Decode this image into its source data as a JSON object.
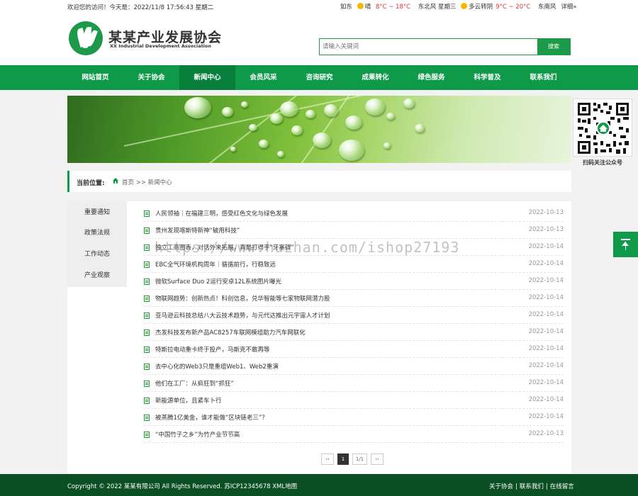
{
  "topbar": {
    "welcome": "欢迎您的访问！今天是：2022/11/8 17:56:43 星期二",
    "weather_city": "如东",
    "weather_today_text": "晴",
    "weather_today_temp": "8°C ~ 18°C",
    "weather_today_wind": "东北风 星期三",
    "weather_tomorrow_text": "多云转阴",
    "weather_tomorrow_temp": "9°C ~ 20°C",
    "weather_tomorrow_wind": "东南风",
    "weather_more": "详细»"
  },
  "header": {
    "logo_cn": "某某产业发展协会",
    "logo_en": "XX Industrial Development Association",
    "search_placeholder": "请输入关键词",
    "search_button": "搜索"
  },
  "nav": {
    "items": [
      "网站首页",
      "关于协会",
      "新闻中心",
      "会员风采",
      "咨询研究",
      "成果转化",
      "绿色服务",
      "科学普及",
      "联系我们"
    ],
    "active_index": 2
  },
  "qr": {
    "caption": "扫码关注公众号"
  },
  "breadcrumb": {
    "label": "当前位置:",
    "path": "首页 >> 新闻中心"
  },
  "sidebar": {
    "items": [
      "重要通知",
      "政策法规",
      "工作动态",
      "产业观察"
    ]
  },
  "news": [
    {
      "title": "人民领袖｜在福建三明，感受红色文化与绿色发展",
      "date": "2022-10-13"
    },
    {
      "title": "贵州发现喀斯特新神“破用科技”",
      "date": "2022-10-13"
    },
    {
      "title": "独立工商图表，对话外来拓展，真是打得手“牙塞碍”",
      "date": "2022-10-14"
    },
    {
      "title": "EBC全气环境机构周年｜循循前行，行稳致远",
      "date": "2022-10-14"
    },
    {
      "title": "微软Surface Duo 2运行安卓12L系统图片曝光",
      "date": "2022-10-14"
    },
    {
      "title": "物联网趋势：创新热点！科创信息，兑华智能等七家物联网潜力股",
      "date": "2022-10-14"
    },
    {
      "title": "亚马逊云科技总结八大云技术趋势，与元代达推出元宇宙人才计划",
      "date": "2022-10-14"
    },
    {
      "title": "杰发科技发布新产品AC8257车联网模组助力汽车网联化",
      "date": "2022-10-14"
    },
    {
      "title": "特斯拉电动重卡终于投产，马斯克不敢再等",
      "date": "2022-10-14"
    },
    {
      "title": "去中心化的Web3只是重组Web1、Web2重演",
      "date": "2022-10-14"
    },
    {
      "title": "他们在工厂：从疯狂到“抓狂”",
      "date": "2022-10-14"
    },
    {
      "title": "新能源单位，且紧车卜行",
      "date": "2022-10-14"
    },
    {
      "title": "被蒸腾1亿美金，谁才能做“区块链老三”？",
      "date": "2022-10-14"
    },
    {
      "title": "“中国竹子之乡”为竹产业节节高",
      "date": "2022-10-13"
    }
  ],
  "pager": {
    "prev": "‹‹",
    "current": "1",
    "total": "1/1",
    "next": "››"
  },
  "watermark": "https://www.huzhan.com/ishop27193",
  "footer": {
    "copyright": "Copyright © 2022 某某有限公司 All Rights Reserved.  苏ICP12345678  XML地图",
    "link_about": "关于协会",
    "link_contact": "联系我们",
    "link_message": "在线留言"
  },
  "colors": {
    "brand_green": "#0f9a4a",
    "footer_green": "#0b4f24",
    "temp_high": "#d33333",
    "temp_low": "#2a9d3a"
  }
}
